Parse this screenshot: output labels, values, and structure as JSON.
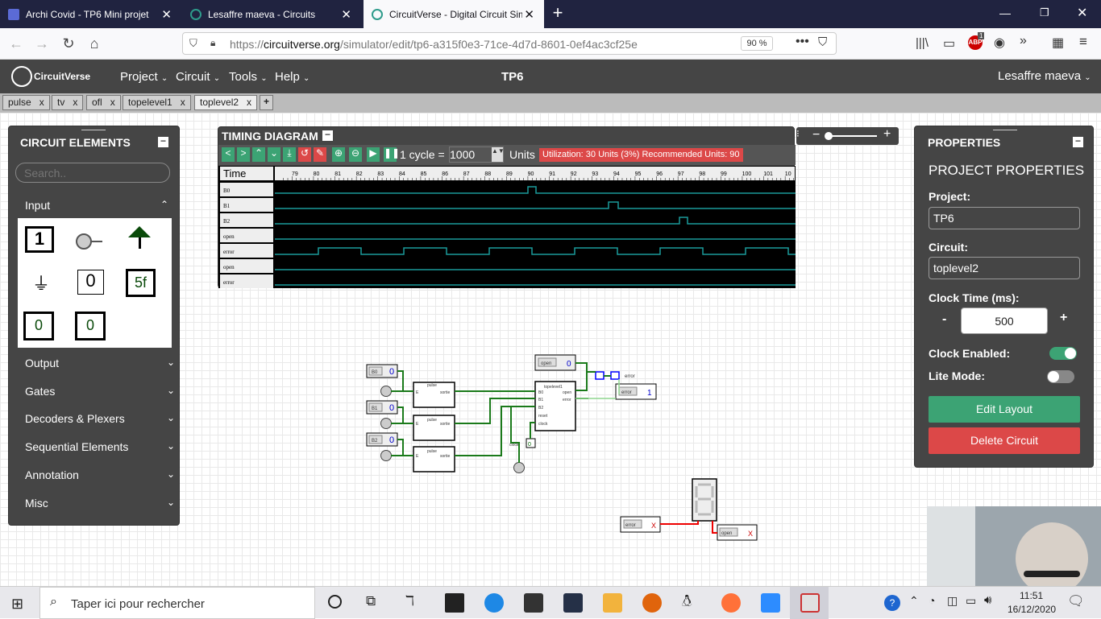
{
  "browser": {
    "tabs": [
      {
        "title": "Archi Covid - TP6 Mini projet",
        "active": false,
        "icon_color": "#5b6bd6"
      },
      {
        "title": "Lesaffre maeva - Circuits",
        "active": false,
        "icon_color": "#2e7d6b"
      },
      {
        "title": "CircuitVerse - Digital Circuit Sim",
        "active": true,
        "icon_color": "#2e7d6b"
      }
    ],
    "new_tab_label": "+",
    "url_prefix": "https://",
    "url_domain": "circuitverse.org",
    "url_path": "/simulator/edit/tp6-a315f0e3-71ce-4d7d-8601-0ef4ac3cf25e",
    "zoom": "90 %",
    "abp_badge": "1"
  },
  "cv": {
    "logo": "CircuitVerse",
    "menus": [
      "Project",
      "Circuit",
      "Tools",
      "Help"
    ],
    "project_title": "TP6",
    "user": "Lesaffre maeva",
    "circuit_tabs": [
      "pulse",
      "tv",
      "ofl",
      "topelevel1",
      "toplevel2"
    ],
    "add_tab": "+"
  },
  "elements_panel": {
    "title": "CIRCUIT ELEMENTS",
    "search_placeholder": "Search..",
    "categories": [
      "Input",
      "Output",
      "Gates",
      "Decoders & Plexers",
      "Sequential Elements",
      "Annotation",
      "Misc"
    ],
    "input_icons": [
      "1",
      "",
      "",
      "",
      "0",
      "5f",
      "0",
      "0"
    ]
  },
  "timing": {
    "title": "TIMING DIAGRAM",
    "cycle_label": "1 cycle =",
    "cycle_value": "1000",
    "units": "Units",
    "utilization": "Utilization: 30 Units (3%) Recommended Units: 90",
    "time_label": "Time",
    "ticks": [
      "79",
      "80",
      "81",
      "82",
      "83",
      "84",
      "85",
      "86",
      "87",
      "88",
      "89",
      "90",
      "91",
      "92",
      "93",
      "94",
      "95",
      "96",
      "97",
      "98",
      "99",
      "100",
      "101",
      "10"
    ],
    "signals": [
      "B0",
      "B1",
      "B2",
      "open",
      "error",
      "open",
      "error"
    ]
  },
  "properties": {
    "title": "PROPERTIES",
    "section": "PROJECT PROPERTIES",
    "project_label": "Project:",
    "project_value": "TP6",
    "circuit_label": "Circuit:",
    "circuit_value": "toplevel2",
    "clock_label": "Clock Time (ms):",
    "clock_value": "500",
    "minus": "-",
    "plus": "+",
    "clock_enabled_label": "Clock Enabled:",
    "lite_mode_label": "Lite Mode:",
    "edit_layout": "Edit Layout",
    "delete_circuit": "Delete Circuit",
    "colors": {
      "green": "#3ca374",
      "red": "#dc4848"
    }
  },
  "zoom_ctrl": {
    "minus": "−",
    "plus": "+"
  },
  "circuit": {
    "inputs": [
      {
        "label": "B0",
        "value": "0"
      },
      {
        "label": "B1",
        "value": "0"
      },
      {
        "label": "B2",
        "value": "0"
      }
    ],
    "pulse_label": "pulse",
    "pulse_out": "sortie",
    "pulse_in": "E",
    "top_label": "topelevel1",
    "top_inputs": [
      "B0",
      "B1",
      "B2",
      "reset",
      "clock"
    ],
    "top_outputs": [
      "open",
      "error"
    ],
    "open_label": "open",
    "open_value": "0",
    "error_label": "error",
    "error_value": "1",
    "error_text": "error",
    "clock_text": "clock",
    "probe": "0",
    "x_mark": "X",
    "error2_label": "error",
    "open2_label": "open"
  },
  "taskbar": {
    "search": "Taper ici pour rechercher",
    "time": "11:51",
    "date": "16/12/2020"
  }
}
